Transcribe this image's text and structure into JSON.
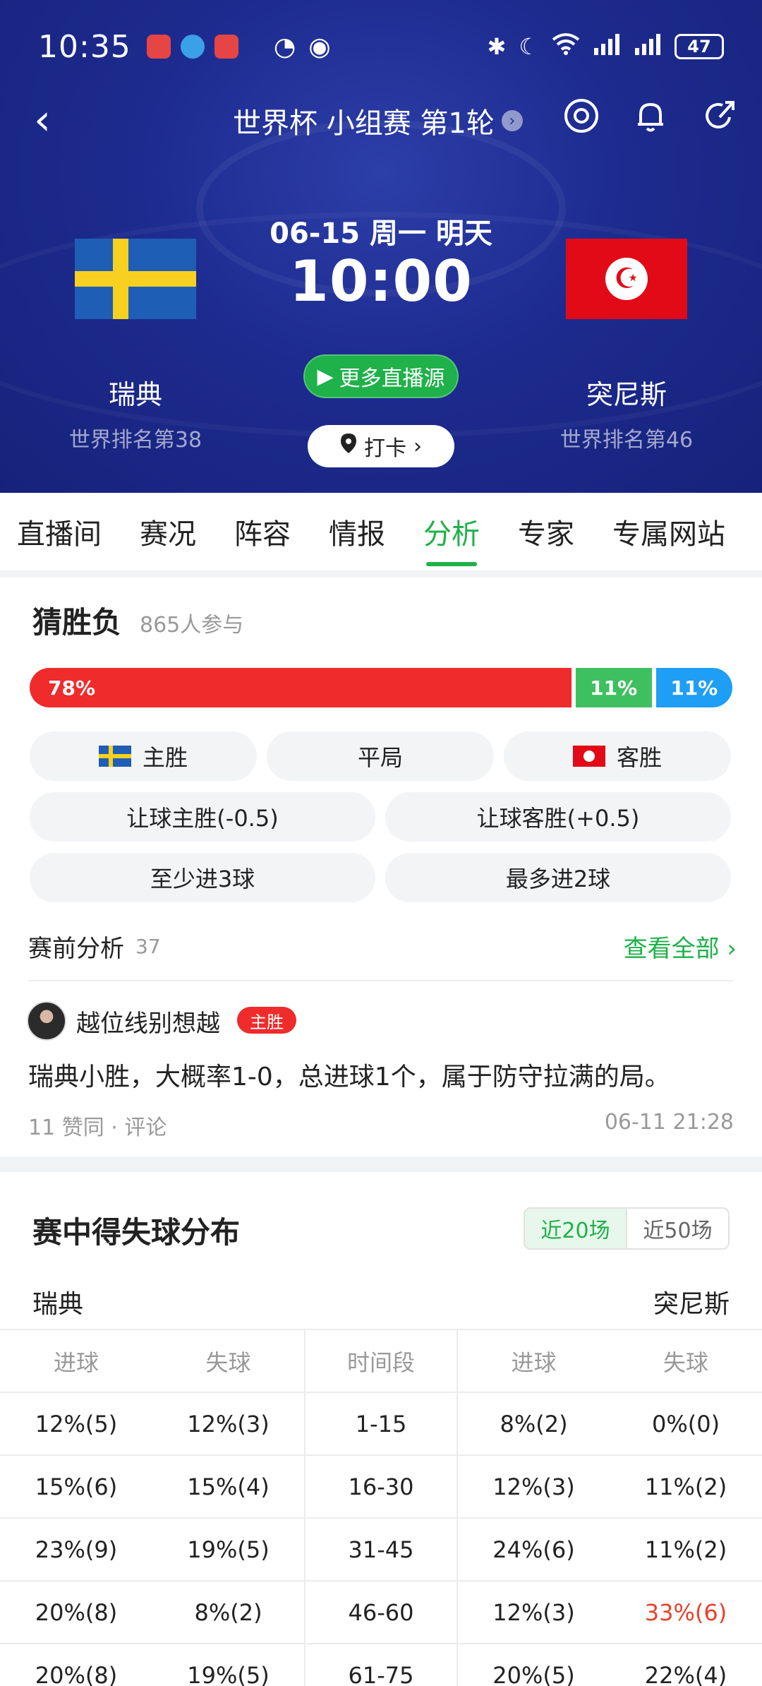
{
  "status_bar": {
    "time": "10:35",
    "battery": "47"
  },
  "nav": {
    "title": "世界杯 小组赛 第1轮"
  },
  "match": {
    "date": "06-15 周一 明天",
    "time": "10:00",
    "home": {
      "name": "瑞典",
      "rank": "世界排名第38"
    },
    "away": {
      "name": "突尼斯",
      "rank": "世界排名第46"
    },
    "live_button": "更多直播源",
    "checkin_button": "打卡"
  },
  "tabs": [
    "直播间",
    "赛况",
    "阵容",
    "情报",
    "分析",
    "专家",
    "专属网站"
  ],
  "active_tab": "分析",
  "prediction": {
    "title": "猜胜负",
    "participants": "865人参与",
    "ratios": {
      "home": 78,
      "draw": 11,
      "away": 11
    },
    "home_label": "78%",
    "draw_label": "11%",
    "away_label": "11%",
    "options": {
      "home_win": "主胜",
      "draw": "平局",
      "away_win": "客胜",
      "handicap_home": "让球主胜(-0.5)",
      "handicap_away": "让球客胜(+0.5)",
      "over": "至少进3球",
      "under": "最多进2球"
    }
  },
  "pre_analysis": {
    "title": "赛前分析",
    "count": "37",
    "see_all": "查看全部",
    "post": {
      "author": "越位线别想越",
      "badge": "主胜",
      "text": "瑞典小胜，大概率1-0，总进球1个，属于防守拉满的局。",
      "meta": "11 赞同 · 评论",
      "time": "06-11 21:28"
    }
  },
  "distribution": {
    "title": "赛中得失球分布",
    "toggle": [
      "近20场",
      "近50场"
    ],
    "home_team": "瑞典",
    "away_team": "突尼斯",
    "headers": [
      "进球",
      "失球",
      "时间段",
      "进球",
      "失球"
    ],
    "rows": [
      [
        "12%(5)",
        "12%(3)",
        "1-15",
        "8%(2)",
        "0%(0)"
      ],
      [
        "15%(6)",
        "15%(4)",
        "16-30",
        "12%(3)",
        "11%(2)"
      ],
      [
        "23%(9)",
        "19%(5)",
        "31-45",
        "24%(6)",
        "11%(2)"
      ],
      [
        "20%(8)",
        "8%(2)",
        "46-60",
        "12%(3)",
        "33%(6)"
      ],
      [
        "20%(8)",
        "19%(5)",
        "61-75",
        "20%(5)",
        "22%(4)"
      ]
    ],
    "highlight_color": "#e8412b"
  },
  "colors": {
    "accent": "#1fb14a",
    "home": "#ef2b2b",
    "draw": "#3fc060",
    "away": "#1e9ef4",
    "header_bg": "#1d2b8f"
  }
}
